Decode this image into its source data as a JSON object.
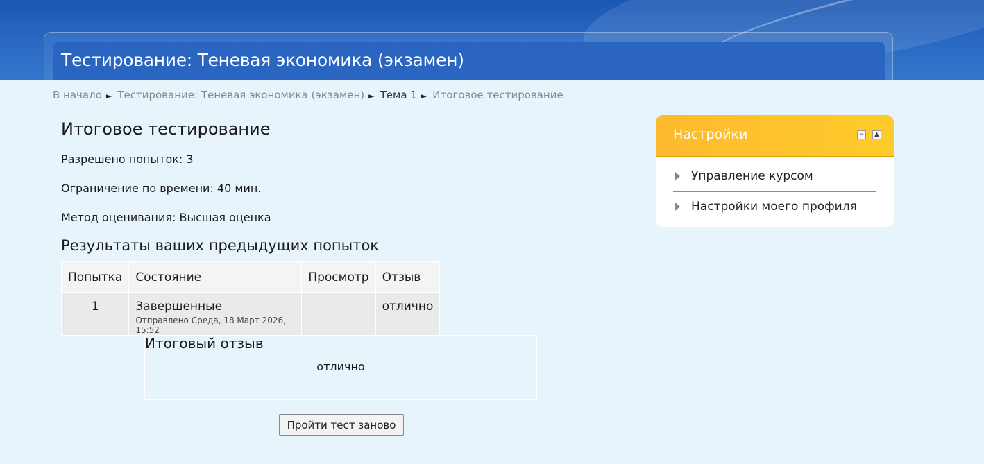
{
  "header": {
    "course_title": "Тестирование: Теневая экономика (экзамен)"
  },
  "breadcrumb": {
    "items": [
      "В начало",
      "Тестирование: Теневая экономика (экзамен)",
      "Тема 1",
      "Итоговое тестирование"
    ],
    "separator": "►"
  },
  "quiz": {
    "name": "Итоговое тестирование",
    "attempts_allowed": "Разрешено попыток: 3",
    "time_limit": "Ограничение по времени: 40 мин.",
    "grading_method": "Метод оценивания: Высшая оценка",
    "results_heading": "Результаты ваших предыдущих попыток"
  },
  "table": {
    "headers": [
      "Попытка",
      "Состояние",
      "Просмотр",
      "Отзыв"
    ],
    "rows": [
      {
        "attempt": "1",
        "state": "Завершенные",
        "submitted": "Отправлено Среда, 18 Март 2026, 15:52",
        "review": "",
        "feedback": "отлично"
      }
    ]
  },
  "overall_feedback": {
    "title": "Итоговый отзыв",
    "text": "отлично"
  },
  "retake_button": "Пройти тест заново",
  "settings_block": {
    "title": "Настройки",
    "items": [
      "Управление курсом",
      "Настройки моего профиля"
    ],
    "header_color": "#fdb92f"
  },
  "colors": {
    "banner": "#1b57b3",
    "background": "#e8f4fc"
  }
}
